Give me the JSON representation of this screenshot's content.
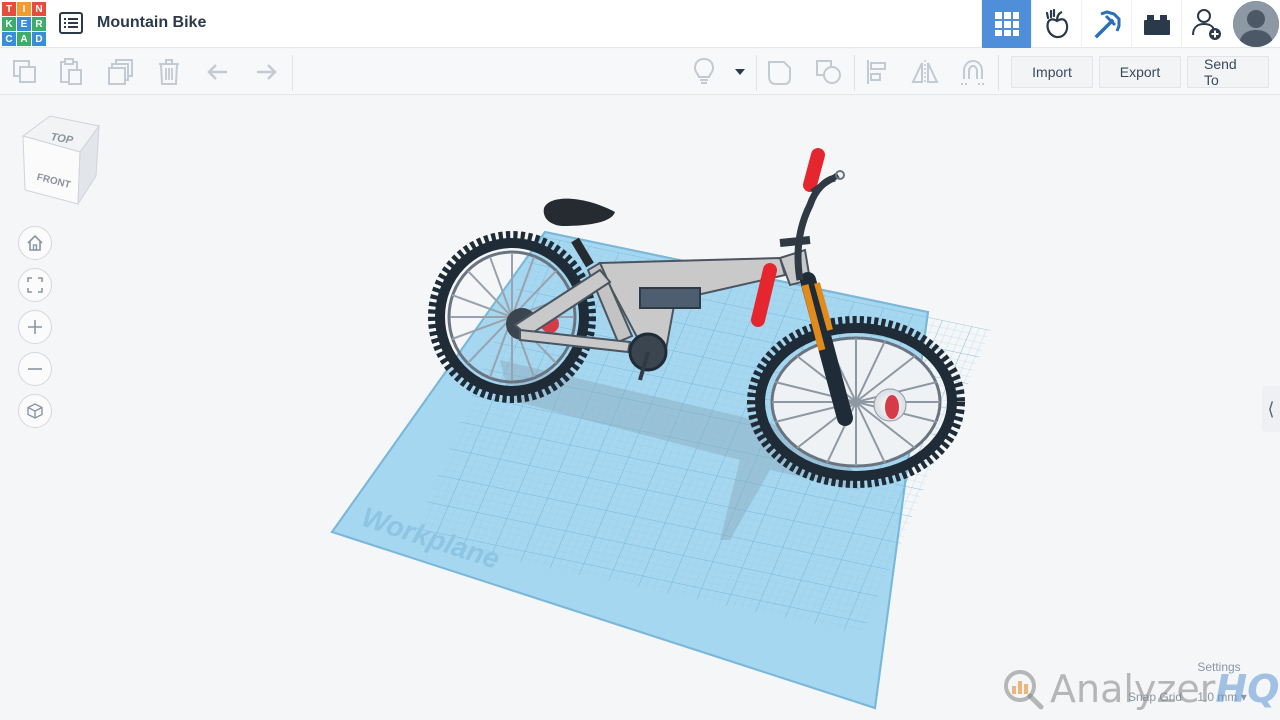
{
  "header": {
    "logo_letters": [
      "T",
      "I",
      "N",
      "K",
      "E",
      "R",
      "C",
      "A",
      "D"
    ],
    "logo_colors": [
      "#e64d3c",
      "#f39c2d",
      "#e64d3c",
      "#3cae6a",
      "#3a8ed8",
      "#3cae6a",
      "#3a8ed8",
      "#3cae6a",
      "#3a8ed8"
    ],
    "document_title": "Mountain Bike",
    "active_view_color": "#4f8ed9"
  },
  "toolbar": {
    "import_label": "Import",
    "export_label": "Export",
    "send_to_label": "Send To"
  },
  "view_cube": {
    "top_label": "TOP",
    "front_label": "FRONT"
  },
  "workplane": {
    "label": "Workplane",
    "color": "#a6d7f0"
  },
  "bike": {
    "frame_color": "#c9c9c9",
    "grip_color": "#e6262e",
    "fork_color": "#e38a1c",
    "rotor_color": "#d63b48",
    "tire_color": "#1f2b36",
    "seat_color": "#252b30"
  },
  "status": {
    "settings_label": "Settings",
    "snap_grid_label": "Snap Grid",
    "snap_grid_value": "1.0 mm"
  },
  "watermark": {
    "text": "Analyzer",
    "accent": "HQ"
  }
}
